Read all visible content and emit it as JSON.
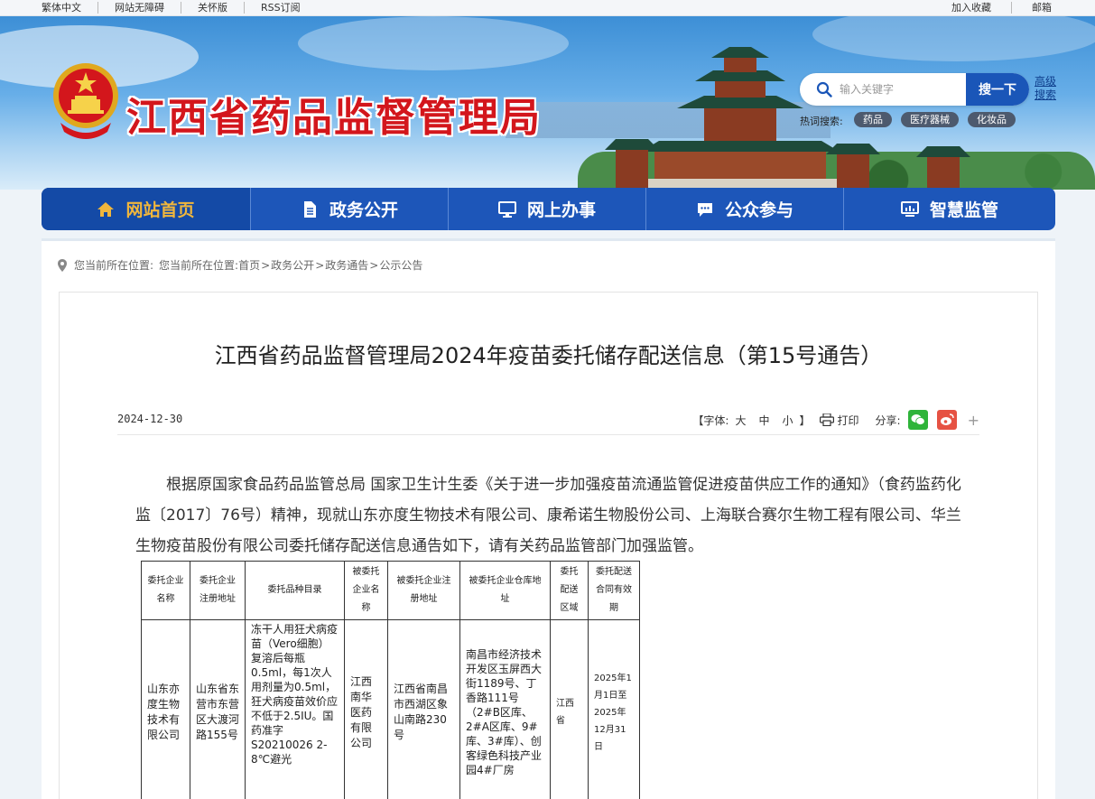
{
  "topbar": {
    "left": [
      "繁体中文",
      "网站无障碍",
      "关怀版",
      "RSS订阅"
    ],
    "right": [
      "加入收藏",
      "邮箱"
    ]
  },
  "header": {
    "site_title": "江西省药品监督管理局",
    "search_placeholder": "输入关键字",
    "search_button": "搜一下",
    "advanced_search": "高级搜索",
    "hot_label": "热词搜索:",
    "hot_tags": [
      "药品",
      "医疗器械",
      "化妆品"
    ]
  },
  "nav": [
    {
      "label": "网站首页",
      "icon": "home-icon"
    },
    {
      "label": "政务公开",
      "icon": "document-icon"
    },
    {
      "label": "网上办事",
      "icon": "monitor-icon"
    },
    {
      "label": "公众参与",
      "icon": "chat-icon"
    },
    {
      "label": "智慧监管",
      "icon": "dashboard-icon"
    }
  ],
  "breadcrumb": {
    "label": "您当前所在位置:",
    "path": [
      "您当前所在位置:",
      "首页",
      "政务公开",
      "政务通告",
      "公示公告"
    ]
  },
  "article": {
    "title": "江西省药品监督管理局2024年疫苗委托储存配送信息（第15号通告）",
    "date": "2024-12-30",
    "font_label": "【字体:",
    "font_sizes": [
      "大",
      "中",
      "小"
    ],
    "font_close": "】",
    "print": "打印",
    "share": "分享:",
    "more": "+",
    "paragraph": "根据原国家食品药品监管总局 国家卫生计生委《关于进一步加强疫苗流通监管促进疫苗供应工作的通知》（食药监药化监〔2017〕76号）精神，现就山东亦度生物技术有限公司、康希诺生物股份公司、上海联合赛尔生物工程有限公司、华兰生物疫苗股份有限公司委托储存配送信息通告如下，请有关药品监管部门加强监管。"
  },
  "table": {
    "headers": [
      "委托企业名称",
      "委托企业注册地址",
      "委托品种目录",
      "被委托企业名称",
      "被委托企业注册地址",
      "被委托企业仓库地址",
      "委托配送区域",
      "委托配送合同有效期"
    ],
    "rows": [
      [
        "山东亦度生物技术有限公司",
        "山东省东营市东营区大渡河路155号",
        "冻干人用狂犬病疫苗（Vero细胞）复溶后每瓶0.5ml，每1次人用剂量为0.5ml，狂犬病疫苗效价应不低于2.5IU。国药准字S20210026 2-8℃避光",
        "江西南华医药有限公司",
        "江西省南昌市西湖区象山南路230号",
        "南昌市经济技术开发区玉屏西大街1189号、丁香路111号（2#B区库、2#A区库、9#库、3#库）、创客绿色科技产业园4#厂房",
        "江西省",
        "2025年1月1日至2025年12月31日"
      ]
    ]
  },
  "colors": {
    "nav_bg": "#1d56b9",
    "nav_active_text": "#f0b63c",
    "title_red": "#d3161c"
  }
}
